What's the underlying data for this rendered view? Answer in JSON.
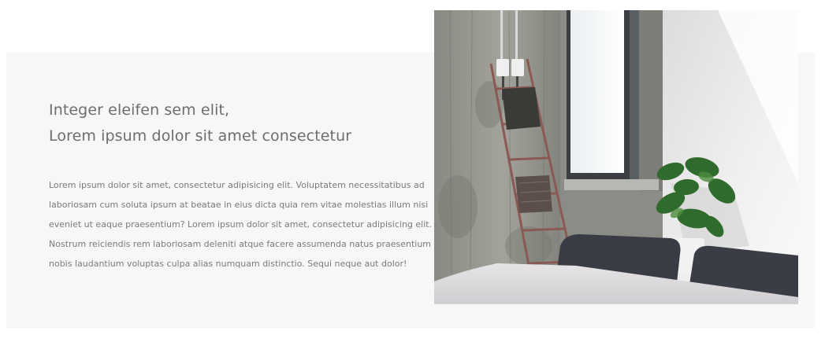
{
  "feature": {
    "heading_line1": "Integer eleifen sem elit,",
    "heading_line2": "Lorem ipsum dolor sit amet consectetur",
    "body_lines": [
      "Lorem ipsum dolor sit amet, consectetur adipisicing elit. Voluptatem necessitatibus ad",
      "laboriosam cum soluta ipsum at beatae in eius dicta quia rem vitae molestias illum nisi",
      "eveniet ut eaque praesentium? Lorem ipsum dolor sit amet, consectetur adipisicing elit.",
      "Nostrum reiciendis rem laboriosam deleniti atque facere assumenda natus praesentium iure",
      "nobis laudantium voluptas culpa alias numquam distinctio. Sequi neque aut dolor!"
    ]
  },
  "colors": {
    "panel_background": "#f7f7f7",
    "heading_text": "#6d6d6d",
    "body_text": "#7a7a7a"
  }
}
